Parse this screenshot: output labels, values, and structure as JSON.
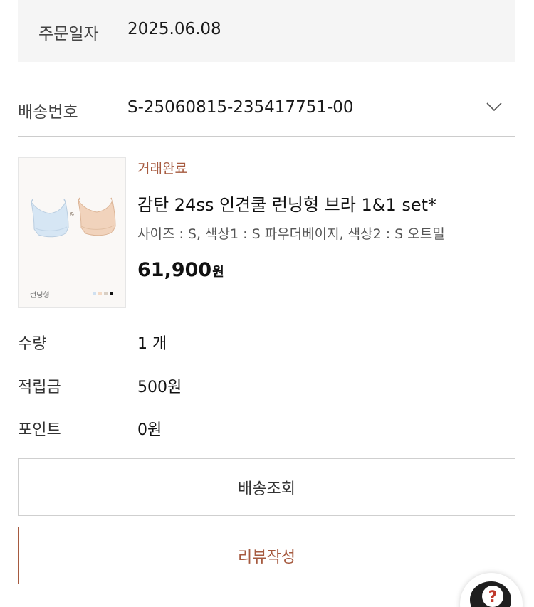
{
  "order_date": {
    "label": "주문일자",
    "value": "2025.06.08"
  },
  "shipping": {
    "label": "배송번호",
    "number": "S-25060815-235417751-00",
    "toggle_icon": "chevron-down-icon"
  },
  "product": {
    "status": "거래완료",
    "name": "감탄 24ss 인견쿨 런닝형 브라 1&1 set*",
    "options": "사이즈 : S, 색상1 : S 파우더베이지, 색상2 : S 오트밀",
    "price": "61,900",
    "price_unit": "원",
    "thumbnail": {
      "caption": "런닝형",
      "ampersand": "&",
      "swatch_colors": [
        "#cfe0f0",
        "#f3d9c4",
        "#d8cfc4",
        "#111111"
      ]
    }
  },
  "details": [
    {
      "label": "수량",
      "value": "1 개"
    },
    {
      "label": "적립금",
      "value": "500원"
    },
    {
      "label": "포인트",
      "value": "0원"
    }
  ],
  "buttons": {
    "track": "배송조회",
    "review": "리뷰작성"
  },
  "help": {
    "icon": "help-question-icon",
    "glyph": "?"
  },
  "colors": {
    "accent": "#a65a3f",
    "panel_bg": "#f5f5f5",
    "border": "#cfcfcf"
  }
}
